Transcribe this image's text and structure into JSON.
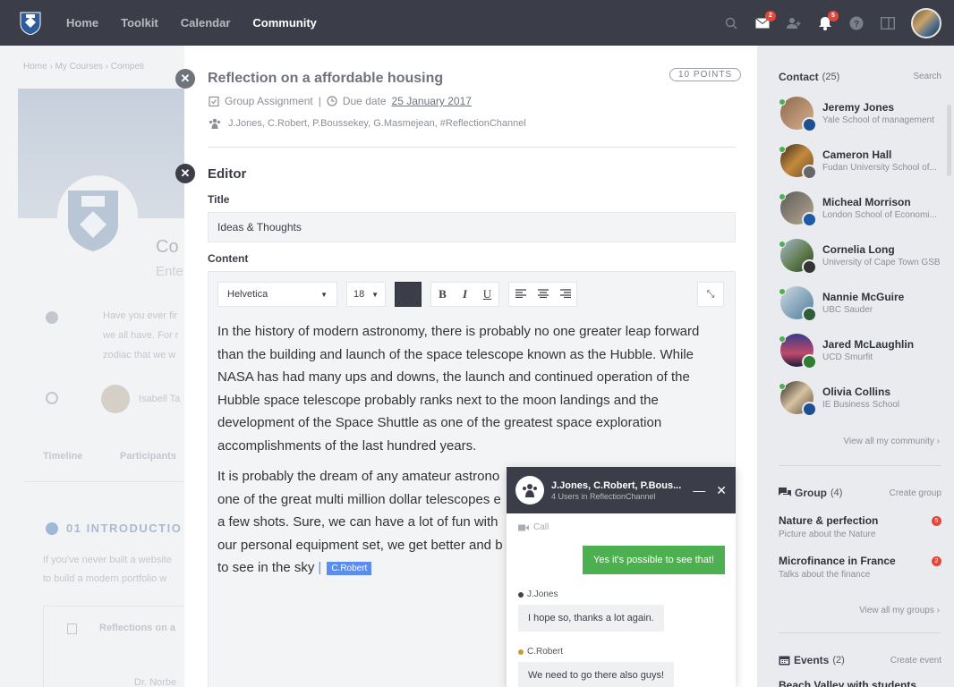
{
  "nav": {
    "items": [
      "Home",
      "Toolkit",
      "Calendar",
      "Community"
    ],
    "active": "Community"
  },
  "topbar": {
    "mail_badge": "2",
    "bell_badge": "5"
  },
  "background": {
    "breadcrumb": "Home › My Courses › Competi",
    "course_partial": "Co",
    "sub_partial": "Ente",
    "desc_lines": [
      "Have you ever fir",
      "we all have. For r",
      "zodiac that we w"
    ],
    "person_partial": "Isabell Ta",
    "tabs": [
      "Timeline",
      "Participants"
    ],
    "section": "01 INTRODUCTIO",
    "section_text": [
      "If you've never built a website",
      "to build a modern portfolio w"
    ],
    "card_title": "Reflections on a",
    "card_sub": "Dr. Norbe"
  },
  "modal": {
    "title": "Reflection on a affordable housing",
    "points": "10 POINTS",
    "type": "Group Assignment",
    "due_label": "Due date",
    "due_date": "25 January 2017",
    "members": "J.Jones, C.Robert, P.Boussekey, G.Masmejean, #ReflectionChannel",
    "editor_heading": "Editor",
    "title_label": "Title",
    "title_value": "Ideas & Thoughts",
    "content_label": "Content",
    "font": "Helvetica",
    "font_size": "18",
    "paragraph1": "In the history of modern astronomy, there is probably no one greater leap forward than the building and launch of the space telescope known as the Hubble. While NASA has had many ups and downs, the launch and continued operation of the Hubble space telescope probably ranks next to the moon landings and the development of the Space Shuttle as one of the greatest space exploration accomplishments of the last hundred years.",
    "p2_lines": [
      "It is probably the dream of any amateur astrono",
      "one of the great multi million dollar telescopes e",
      "a few shots. Sure, we can have a lot of fun with",
      "our personal equipment set, we get better and b",
      "to see in the sky"
    ],
    "cursor_tag": "C.Robert"
  },
  "chat": {
    "title": "J.Jones, C.Robert, P.Bous...",
    "subtitle": "4 Users in ReflectionChannel",
    "call": "Call",
    "my_message": "Yes it's possible to see that!",
    "messages": [
      {
        "sender": "J.Jones",
        "text": "I hope so, thanks a lot again."
      },
      {
        "sender": "C.Robert",
        "text": "We need to go there also guys!"
      }
    ]
  },
  "sidebar": {
    "contact_label": "Contact",
    "contact_count": "(25)",
    "search": "Search",
    "contacts": [
      {
        "name": "Jeremy Jones",
        "school": "Yale School of management"
      },
      {
        "name": "Cameron Hall",
        "school": "Fudan University School of..."
      },
      {
        "name": "Micheal Morrison",
        "school": "London School of Economi..."
      },
      {
        "name": "Cornelia Long",
        "school": "University of Cape Town GSB"
      },
      {
        "name": "Nannie McGuire",
        "school": "UBC Sauder"
      },
      {
        "name": "Jared McLaughlin",
        "school": "UCD Smurfit"
      },
      {
        "name": "Olivia Collins",
        "school": "IE Business School"
      }
    ],
    "view_community": "View all my community",
    "group_label": "Group",
    "group_count": "(4)",
    "create_group": "Create group",
    "groups": [
      {
        "name": "Nature & perfection",
        "desc": "Picture about the Nature",
        "badge": "5"
      },
      {
        "name": "Microfinance in France",
        "desc": "Talks about the finance",
        "badge": "2"
      }
    ],
    "view_groups": "View all my groups",
    "events_label": "Events",
    "events_count": "(2)",
    "create_event": "Create event",
    "event_partial": "Beach Valley with students"
  }
}
